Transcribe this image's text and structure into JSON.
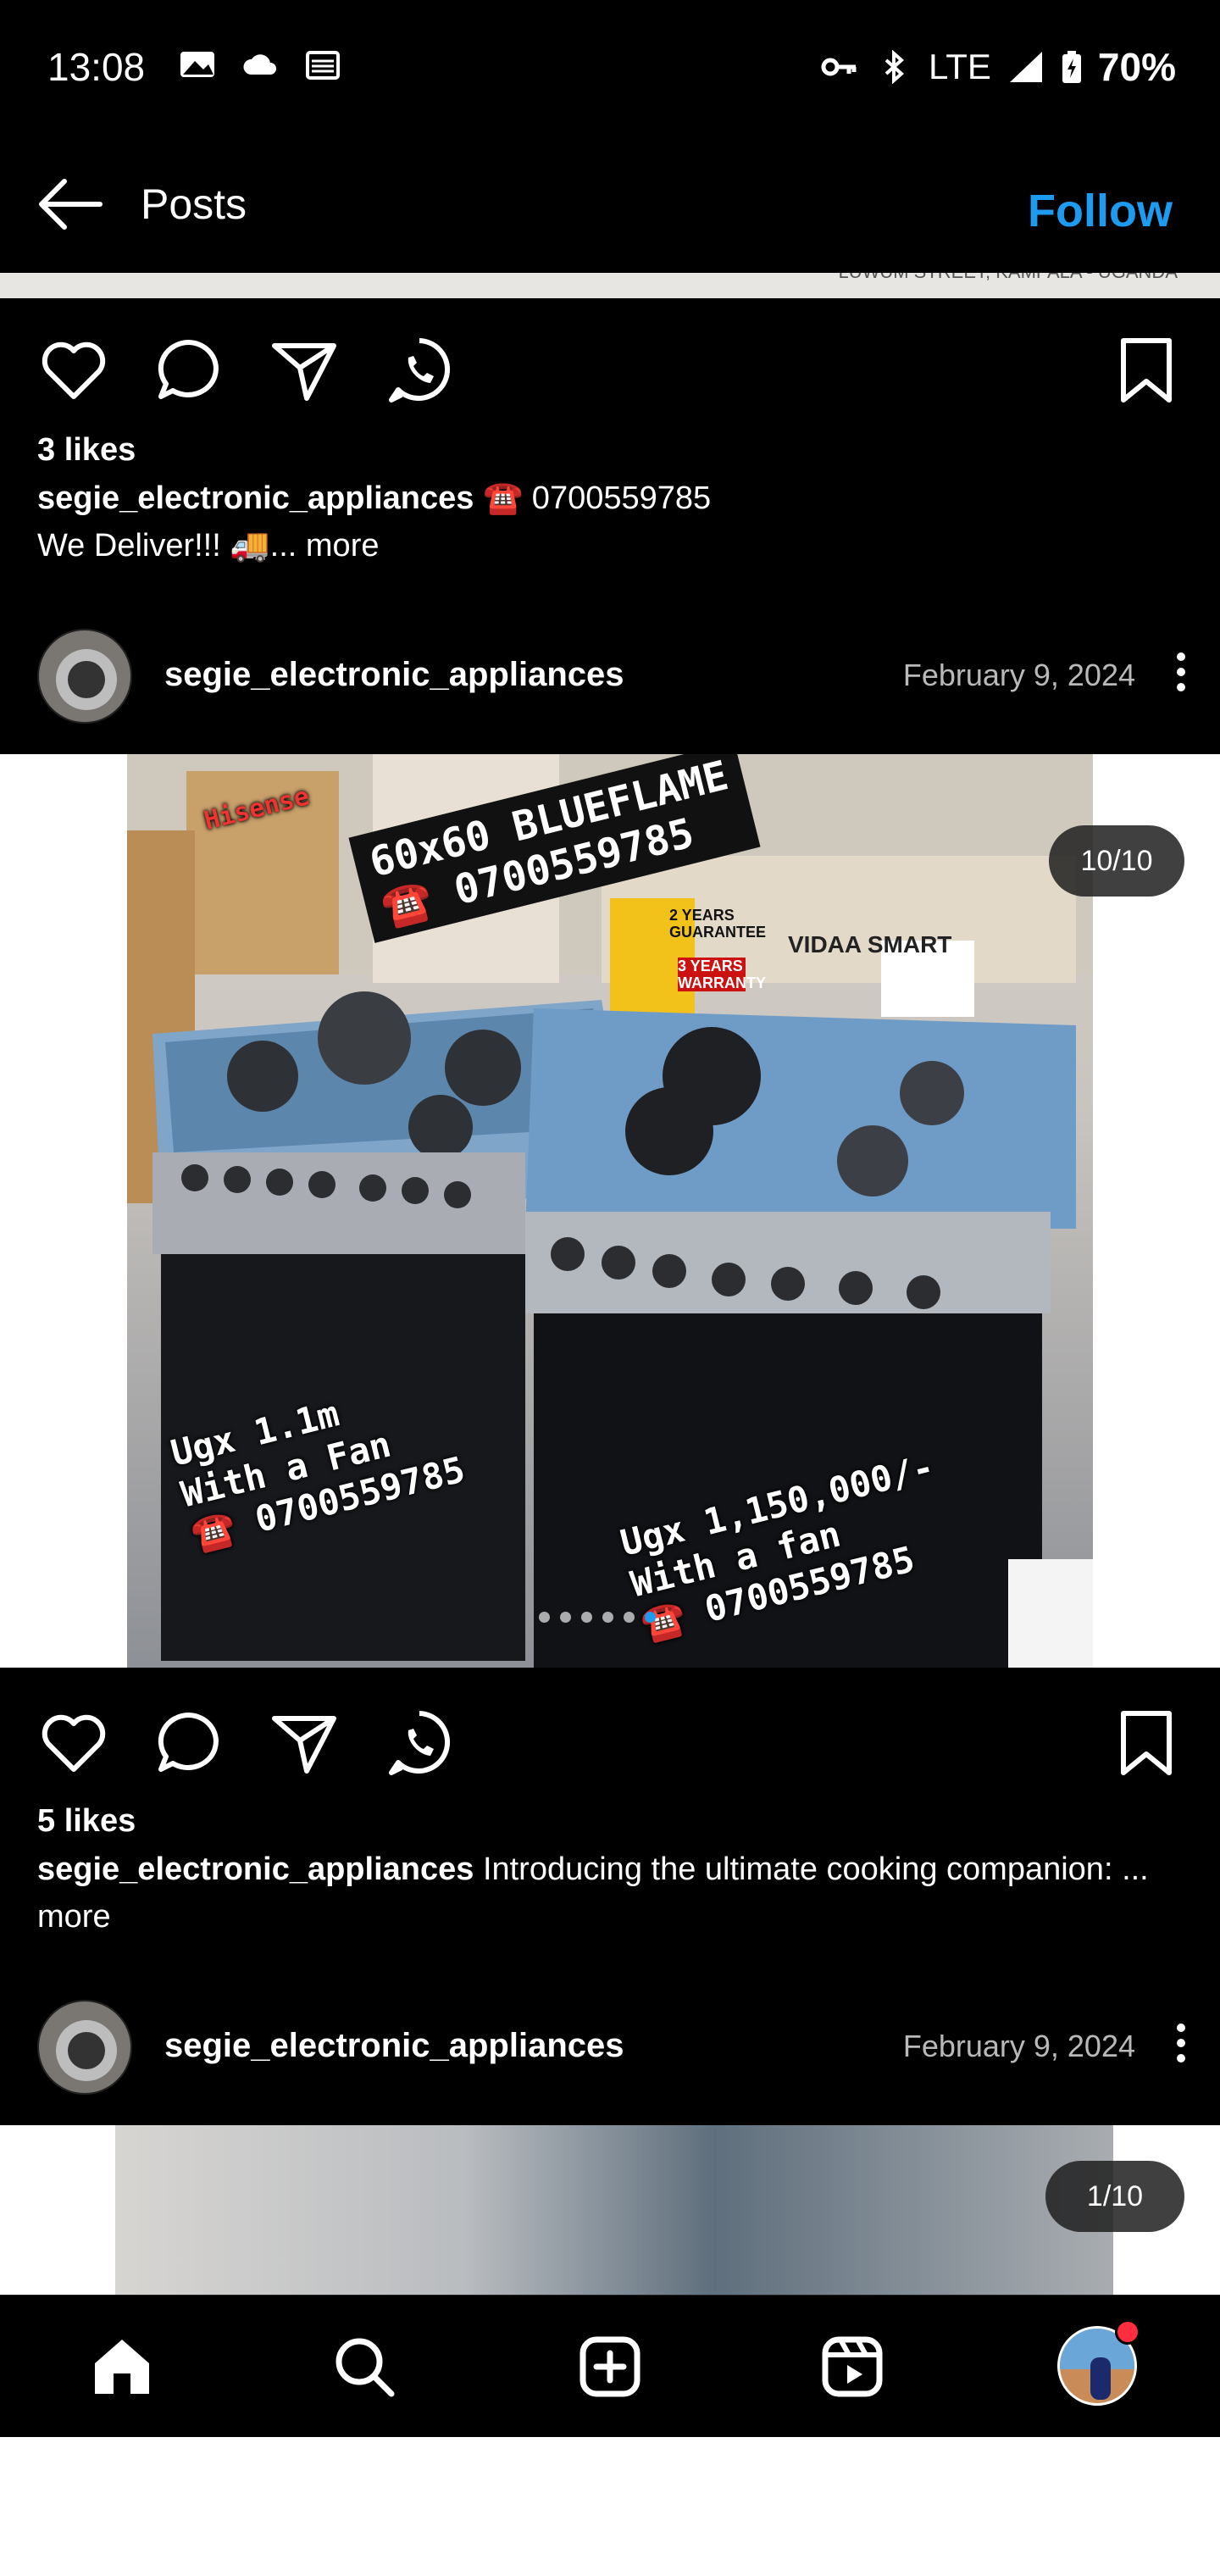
{
  "status_bar": {
    "time": "13:08",
    "network": "LTE",
    "battery": "70%",
    "icons": [
      "image-icon",
      "cloud-icon",
      "cast-icon",
      "key-icon",
      "bluetooth-icon",
      "signal-icon",
      "battery-icon"
    ]
  },
  "header": {
    "title": "Posts",
    "follow_label": "Follow",
    "accent_color": "#1d9bf0"
  },
  "top_strip_text": "LUWUM STREET, KAMPALA - UGANDA",
  "posts": [
    {
      "likes": "3 likes",
      "username": "segie_electronic_appliances",
      "caption_line1": "☎️ 0700559785",
      "caption_line2": "We Deliver!!! 🚚",
      "more": "... more"
    },
    {
      "username": "segie_electronic_appliances",
      "date": "February 9, 2024",
      "counter": "10/10",
      "overlay_title_line1": "60x60 BLUEFLAME",
      "overlay_title_line2": "☎️ 0700559785",
      "overlay_left_line1": "Ugx 1.1m",
      "overlay_left_line2": "With a Fan",
      "overlay_left_line3": "☎️ 0700559785",
      "overlay_right_line1": "Ugx 1,150,000/-",
      "overlay_right_line2": "With a fan",
      "overlay_right_line3": "☎️ 0700559785",
      "box_text_1": "Hisense",
      "box_text_2": "VIDAA SMART",
      "box_text_3": "2 YEARS GUARANTEE",
      "box_text_4": "3 YEARS WARRANTY",
      "likes": "5 likes",
      "caption": "Introducing the ultimate cooking companion: ",
      "more": "... more",
      "carousel_total": 10,
      "carousel_active": 10
    },
    {
      "username": "segie_electronic_appliances",
      "date": "February 9, 2024",
      "counter": "1/10"
    }
  ],
  "bottom_nav": {
    "items": [
      "home-icon",
      "search-icon",
      "create-icon",
      "reels-icon",
      "profile-avatar"
    ]
  }
}
